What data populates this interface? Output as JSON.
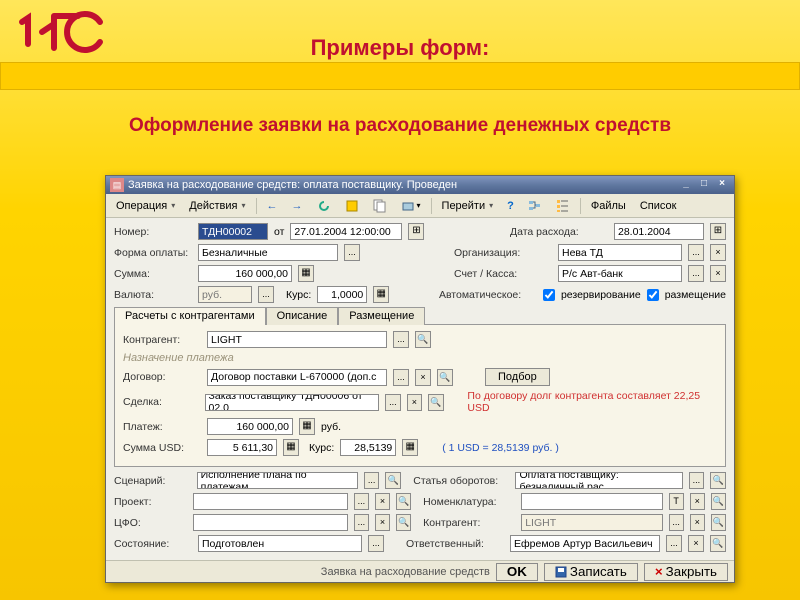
{
  "slide": {
    "title": "Примеры форм:",
    "subtitle": "Оформление заявки на расходование денежных средств"
  },
  "logo": {
    "name": "1c-logo"
  },
  "window": {
    "title": "Заявка на расходование средств: оплата поставщику. Проведен",
    "minimize": "_",
    "maximize": "□",
    "close": "×"
  },
  "toolbar": {
    "operation": "Операция",
    "actions": "Действия",
    "nav_back": "←",
    "nav_fwd": "→",
    "goto": "Перейти",
    "help": "?",
    "files": "Файлы",
    "list": "Список"
  },
  "labels": {
    "number": "Номер:",
    "from": "от",
    "date_exp": "Дата расхода:",
    "pay_form": "Форма оплаты:",
    "org": "Организация:",
    "sum": "Сумма:",
    "acct": "Счет / Касса:",
    "currency": "Валюта:",
    "rate": "Курс:",
    "auto": "Автоматическое:",
    "reserve": "резервирование",
    "placement": "размещение",
    "tab1": "Расчеты с контрагентами",
    "tab2": "Описание",
    "tab3": "Размещение",
    "counterparty": "Контрагент:",
    "purpose": "Назначение платежа",
    "contract": "Договор:",
    "pick": "Подбор",
    "debt_note": "По договору долг контрагента составляет 22,25 USD",
    "deal": "Сделка:",
    "payment": "Платеж:",
    "rub": "руб.",
    "sum_usd": "Сумма USD:",
    "usd_rate": "( 1 USD = 28,5139 руб. )",
    "scenario": "Сценарий:",
    "article": "Статья оборотов:",
    "project": "Проект:",
    "nomenclature": "Номенклатура:",
    "cfo": "ЦФО:",
    "c2": "Контрагент:",
    "state": "Состояние:",
    "responsible": "Ответственный:",
    "footer_hint": "Заявка на расходование средств",
    "ok": "OK",
    "save": "Записать",
    "close": "Закрыть"
  },
  "values": {
    "number": "ТДН00002",
    "date": "27.01.2004 12:00:00",
    "date_exp": "28.01.2004",
    "pay_form": "Безналичные",
    "org": "Нева ТД",
    "sum": "160 000,00",
    "acct": "Р/с Авт-банк",
    "currency": "руб.",
    "rate": "1,0000",
    "counterparty": "LIGHT",
    "contract": "Договор поставки L-670000 (доп.с",
    "deal": "Заказ поставщику ТДН00006 от 02.0",
    "payment": "160 000,00",
    "sum_usd": "5 611,30",
    "rate2": "28,5139",
    "scenario": "Исполнение плана по платежам",
    "article": "Оплата поставщику: безналичный рас",
    "project": "",
    "nomenclature": "",
    "cfo": "",
    "c2": "LIGHT",
    "state": "Подготовлен",
    "responsible": "Ефремов Артур Васильевич"
  }
}
